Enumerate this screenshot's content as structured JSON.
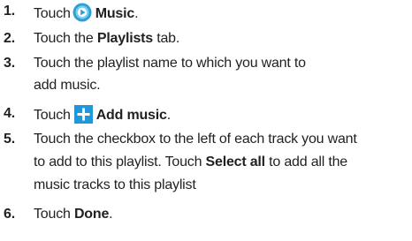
{
  "steps": [
    {
      "number": "1.",
      "pre": "Touch",
      "icon": "music-app-icon",
      "bold": "Music",
      "post": "."
    },
    {
      "number": "2.",
      "pre": "Touch the",
      "bold": "Playlists",
      "post": "tab."
    },
    {
      "number": "3.",
      "line1": "Touch the playlist name to which you want to",
      "line2": "add music."
    },
    {
      "number": "4.",
      "pre": "Touch",
      "icon": "plus-icon",
      "bold": "Add music",
      "post": "."
    },
    {
      "number": "5.",
      "line1": "Touch the checkbox to the left of each track you want",
      "line2_pre": "to add to this playlist. Touch",
      "line2_bold": "Select all",
      "line2_post": "to add all the",
      "line3": "music tracks to this playlist"
    },
    {
      "number": "6.",
      "pre": "Touch",
      "bold": "Done",
      "post": "."
    }
  ],
  "colors": {
    "text": "#231f20",
    "music_icon_outer": "#2f9fd8",
    "music_icon_inner": "#7ccff2",
    "plus_icon_bg": "#1f97d9"
  }
}
